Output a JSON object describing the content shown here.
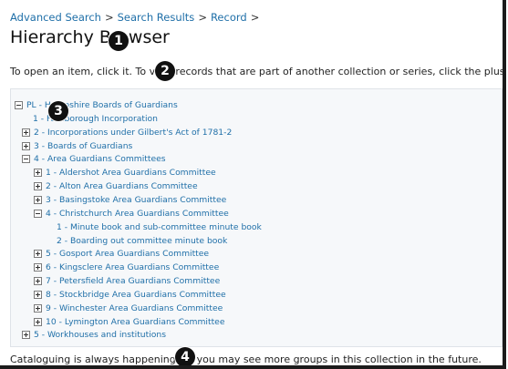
{
  "breadcrumb": {
    "items": [
      "Advanced Search",
      "Search Results",
      "Record"
    ],
    "separator": ">"
  },
  "page": {
    "title": "Hierarchy Browser",
    "instructions": "To open an item, click it. To view records that are part of another collection or series, click the plus at the left.",
    "footer_note": "Cataloguing is always happening, so you may see more groups in this collection in the future."
  },
  "tree": {
    "items": [
      {
        "label": "PL - Hampshire Boards of Guardians",
        "toggle": "minus",
        "level": 0
      },
      {
        "label": "1 - Farnborough Incorporation",
        "toggle": "none",
        "level": 1
      },
      {
        "label": "2 - Incorporations under Gilbert's Act of 1781-2",
        "toggle": "plus",
        "level": 1
      },
      {
        "label": "3 - Boards of Guardians",
        "toggle": "plus",
        "level": 1
      },
      {
        "label": "4 - Area Guardians Committees",
        "toggle": "minus",
        "level": 1
      },
      {
        "label": "1 - Aldershot Area Guardians Committee",
        "toggle": "plus",
        "level": 2
      },
      {
        "label": "2 - Alton Area Guardians Committee",
        "toggle": "plus",
        "level": 2
      },
      {
        "label": "3 - Basingstoke Area Guardians Committee",
        "toggle": "plus",
        "level": 2
      },
      {
        "label": "4 - Christchurch Area Guardians Committee",
        "toggle": "minus",
        "level": 2
      },
      {
        "label": "1 - Minute book and sub-committee minute book",
        "toggle": "none",
        "level": 3
      },
      {
        "label": "2 - Boarding out committee minute book",
        "toggle": "none",
        "level": 3
      },
      {
        "label": "5 - Gosport Area Guardians Committee",
        "toggle": "plus",
        "level": 2
      },
      {
        "label": "6 - Kingsclere Area Guardians Committee",
        "toggle": "plus",
        "level": 2
      },
      {
        "label": "7 - Petersfield Area Guardians Committee",
        "toggle": "plus",
        "level": 2
      },
      {
        "label": "8 - Stockbridge Area Guardians Committee",
        "toggle": "plus",
        "level": 2
      },
      {
        "label": "9 - Winchester Area Guardians Committee",
        "toggle": "plus",
        "level": 2
      },
      {
        "label": "10 - Lymington Area Guardians Committee",
        "toggle": "plus",
        "level": 2
      },
      {
        "label": "5 - Workhouses and institutions",
        "toggle": "plus",
        "level": 1
      }
    ]
  },
  "markers": [
    "1",
    "2",
    "3",
    "4"
  ],
  "colors": {
    "link": "#1f6fa8",
    "panel_bg": "#f6f8fa",
    "marker_bg": "#111111"
  }
}
